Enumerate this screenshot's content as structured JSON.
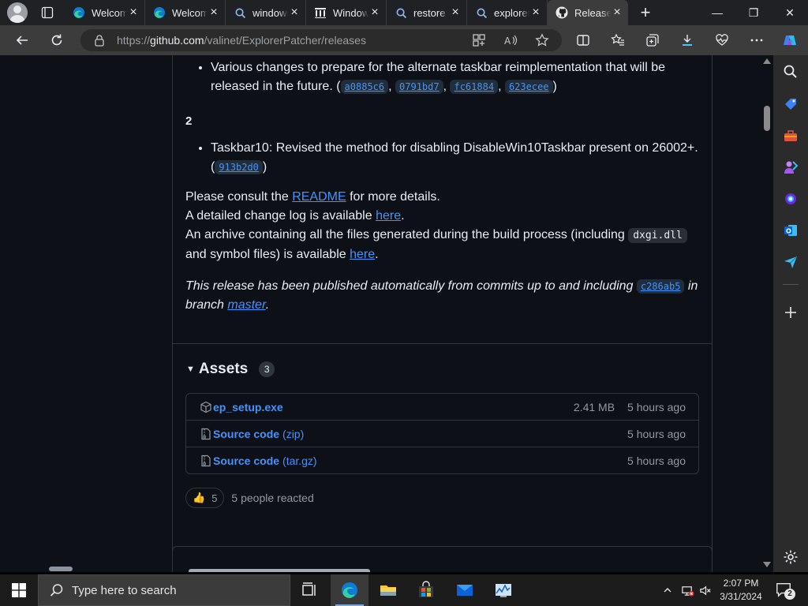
{
  "browser": {
    "tabs": [
      {
        "label": "Welcome",
        "icon": "edge-icon",
        "close": "×"
      },
      {
        "label": "Welcome",
        "icon": "edge-icon",
        "close": "×"
      },
      {
        "label": "windows",
        "icon": "search-icon",
        "close": "×"
      },
      {
        "label": "Windows",
        "icon": "wikipedia-icon",
        "close": "×"
      },
      {
        "label": "restore",
        "icon": "search-icon",
        "close": "×"
      },
      {
        "label": "explorer",
        "icon": "search-icon",
        "close": "×"
      },
      {
        "label": "Releases",
        "icon": "github-icon",
        "close": "×",
        "active": true
      }
    ],
    "new_tab": "+",
    "window_controls": {
      "minimize": "—",
      "maximize": "❐",
      "close": "✕"
    },
    "address": {
      "scheme": "https://",
      "host": "github.com",
      "path": "/valinet/ExplorerPatcher/releases"
    }
  },
  "release": {
    "note_items_top": [
      {
        "text": "Various changes to prepare for the alternate taskbar reimplementation that will be released in the future. (",
        "shas": [
          "a0885c6",
          "0791bd7",
          "fc61884",
          "623ecee"
        ],
        "end": ")"
      }
    ],
    "section_number": "2",
    "note_items_bottom": [
      {
        "text": "Taskbar10: Revised the method for disabling DisableWin10Taskbar present on 26002+. (",
        "shas": [
          "913b2d0"
        ],
        "end": ")"
      }
    ],
    "readme_line": {
      "before": "Please consult the ",
      "link": "README",
      "after": " for more details."
    },
    "changelog_line": {
      "before": "A detailed change log is available ",
      "link": "here",
      "after": "."
    },
    "archive_line": {
      "before": "An archive containing all the files generated during the build process (including ",
      "code": "dxgi.dll",
      "middle": " and symbol files) is available ",
      "link": "here",
      "after": "."
    },
    "auto_line": {
      "before": "This release has been published automatically from commits up to and including ",
      "sha": "c286ab5",
      "middle": " in branch ",
      "link": "master",
      "after": "."
    },
    "assets": {
      "title": "Assets",
      "toggle": "▼",
      "count": "3",
      "items": [
        {
          "name": "ep_setup.exe",
          "sub": "",
          "size": "2.41 MB",
          "time": "5 hours ago",
          "icon": "package-icon"
        },
        {
          "name": "Source code",
          "sub": "(zip)",
          "size": "",
          "time": "5 hours ago",
          "icon": "file-zip-icon"
        },
        {
          "name": "Source code",
          "sub": "(tar.gz)",
          "size": "",
          "time": "5 hours ago",
          "icon": "file-zip-icon"
        }
      ]
    },
    "reactions": {
      "emoji": "👍",
      "count": "5",
      "summary": "5 people reacted"
    }
  },
  "taskbar": {
    "search_placeholder": "Type here to search",
    "time": "2:07 PM",
    "date": "3/31/2024",
    "notification_count": "2"
  },
  "colors": {
    "link": "#4493f8",
    "page_bg": "#0d1117",
    "border": "#30363d"
  }
}
